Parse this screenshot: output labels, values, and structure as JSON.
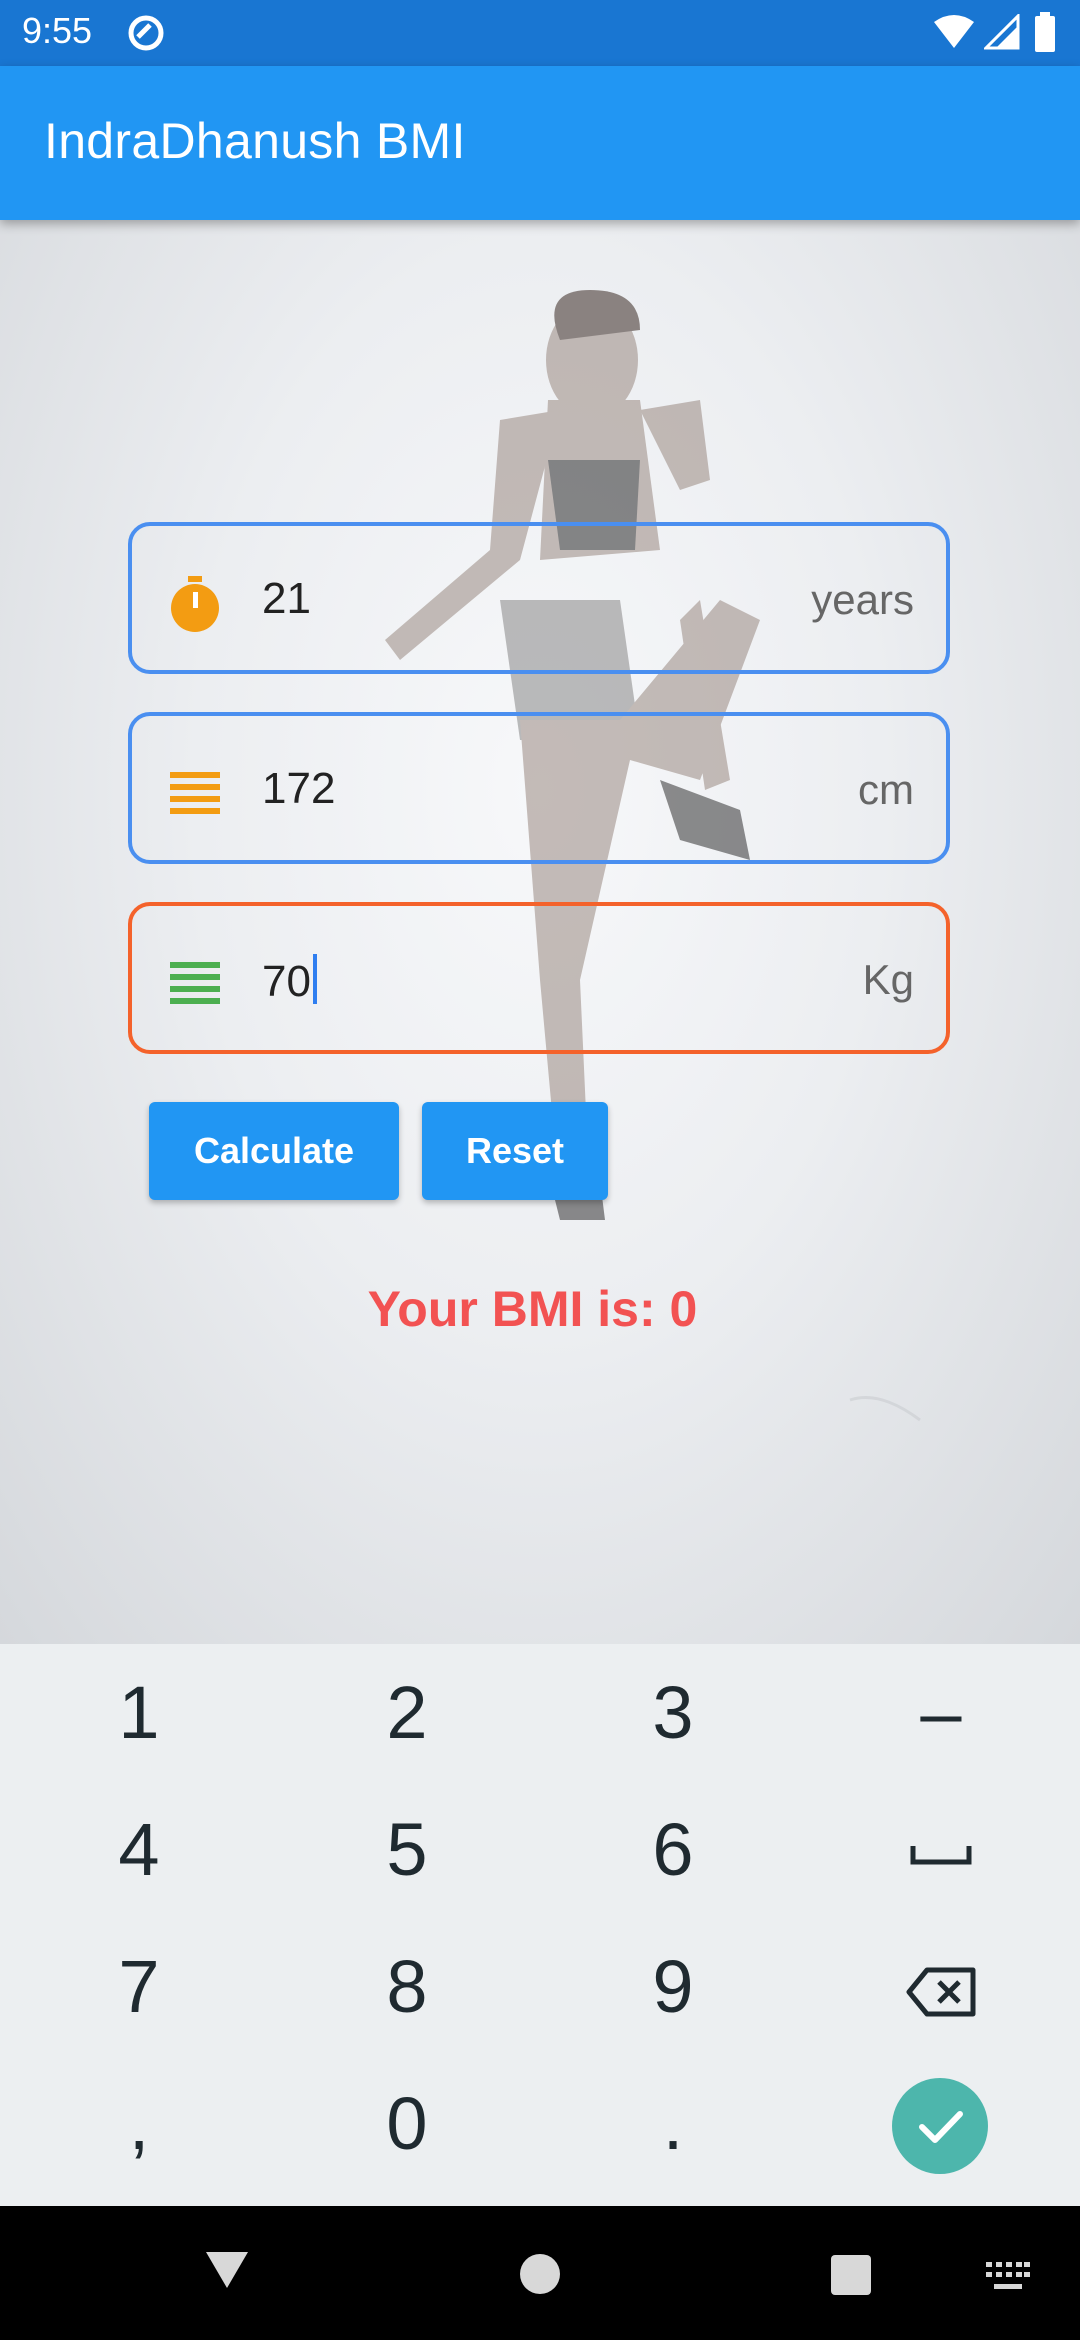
{
  "status_bar": {
    "time": "9:55"
  },
  "app_bar": {
    "title": "IndraDhanush BMI"
  },
  "fields": [
    {
      "name": "age",
      "value": "21",
      "suffix": "years",
      "icon": "stopwatch-icon",
      "color": "#f39c12"
    },
    {
      "name": "height",
      "value": "172",
      "suffix": "cm",
      "icon": "height-lines-icon",
      "color": "#f39c12"
    },
    {
      "name": "weight",
      "value": "70",
      "suffix": "Kg",
      "icon": "weight-lines-icon",
      "color": "#4caf50"
    }
  ],
  "buttons": {
    "calculate": "Calculate",
    "reset": "Reset"
  },
  "result": {
    "text": "Your BMI is: 0"
  },
  "keyboard": {
    "rows": [
      [
        "1",
        "2",
        "3",
        "–"
      ],
      [
        "4",
        "5",
        "6",
        "space"
      ],
      [
        "7",
        "8",
        "9",
        "backspace"
      ],
      [
        ",",
        "0",
        ".",
        "enter"
      ]
    ]
  },
  "colors": {
    "status_bar": "#1976d2",
    "app_bar": "#2196f3",
    "field_border": "#4a8ff0",
    "field_border_focused": "#f4622b",
    "result_text": "#f25252",
    "enter_key": "#4db6ac"
  }
}
